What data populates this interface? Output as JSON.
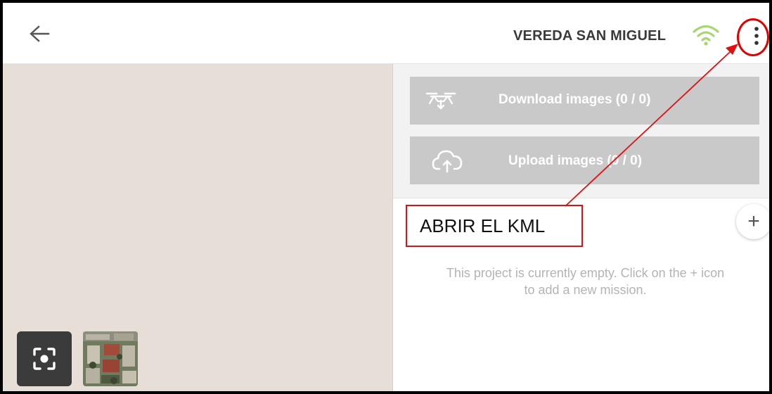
{
  "header": {
    "back_icon": "arrow-left-icon",
    "title": "VEREDA SAN MIGUEL",
    "wifi_icon": "wifi-icon",
    "menu_icon": "more-vertical-icon"
  },
  "map": {
    "locate_icon": "focus-locate-icon",
    "layer_thumbnail": "satellite-layer-thumbnail"
  },
  "panel": {
    "download_label": "Download images (0 / 0)",
    "download_icon": "drone-download-icon",
    "upload_label": "Upload images (0 / 0)",
    "upload_icon": "cloud-upload-icon",
    "add_label": "+",
    "empty_message_line1": "This project is currently empty. Click on the + icon",
    "empty_message_line2": "to add a new mission."
  },
  "annotation": {
    "callout_text": "ABRIR EL KML",
    "highlight_color": "#e50000"
  }
}
